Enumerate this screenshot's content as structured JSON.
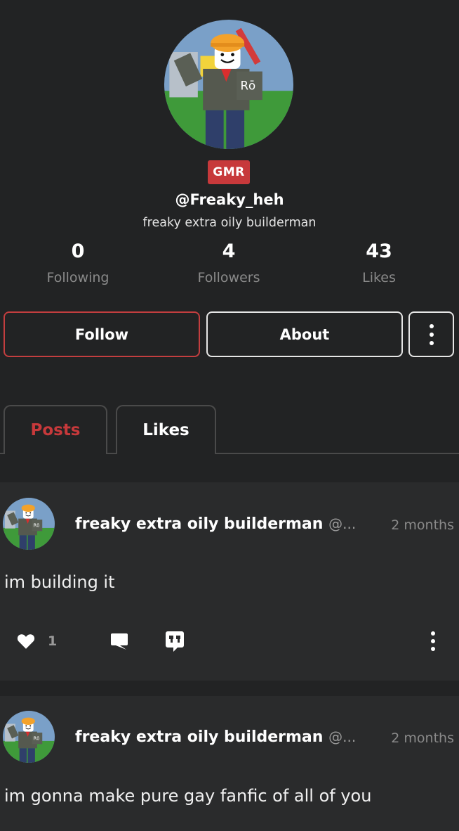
{
  "profile": {
    "badge": "GMR",
    "handle": "@Freaky_heh",
    "bio": "freaky extra oily builderman",
    "stats": [
      {
        "value": "0",
        "label": "Following"
      },
      {
        "value": "4",
        "label": "Followers"
      },
      {
        "value": "43",
        "label": "Likes"
      }
    ],
    "avatar_icon": "roblox-builderman-avatar"
  },
  "actions": {
    "follow_label": "Follow",
    "about_label": "About",
    "more_icon": "vertical-dots-icon"
  },
  "tabs": [
    {
      "label": "Posts",
      "active": true
    },
    {
      "label": "Likes",
      "active": false
    }
  ],
  "posts": [
    {
      "author": "freaky extra oily builderman",
      "handle_truncated": "@...",
      "time": "2 months",
      "text": "im building it",
      "likes": "1"
    },
    {
      "author": "freaky extra oily builderman",
      "handle_truncated": "@...",
      "time": "2 months",
      "text": "im gonna make pure gay fanfic of all of you"
    }
  ],
  "colors": {
    "background": "#222324",
    "post_background": "#2a2b2c",
    "accent_red": "#c7393b",
    "muted_text": "#8a8a8a"
  }
}
